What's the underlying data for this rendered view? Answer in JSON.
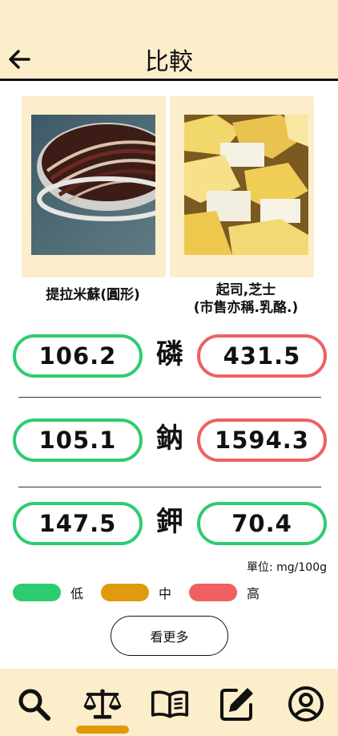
{
  "header": {
    "title": "比較"
  },
  "foods": {
    "left": {
      "name": "提拉米蘇(圓形)"
    },
    "right": {
      "name_line1": "起司,芝士",
      "name_line2": "(市售亦稱.乳酪.)"
    }
  },
  "rows": [
    {
      "nutrient": "磷",
      "left_value": "106.2",
      "left_level": "low",
      "right_value": "431.5",
      "right_level": "high"
    },
    {
      "nutrient": "鈉",
      "left_value": "105.1",
      "left_level": "low",
      "right_value": "1594.3",
      "right_level": "high"
    },
    {
      "nutrient": "鉀",
      "left_value": "147.5",
      "left_level": "low",
      "right_value": "70.4",
      "right_level": "low"
    }
  ],
  "unit": "單位: mg/100g",
  "legend": [
    {
      "label": "低",
      "color": "#2ecc71"
    },
    {
      "label": "中",
      "color": "#e09a0c"
    },
    {
      "label": "高",
      "color": "#f06060"
    }
  ],
  "more_button": "看更多",
  "colors": {
    "low": "#2ecc71",
    "medium": "#e09a0c",
    "high": "#f06060",
    "background": "#fdeecb"
  },
  "nav": {
    "items": [
      "search-icon",
      "scale-icon",
      "book-icon",
      "edit-icon",
      "user-icon"
    ],
    "active": "scale-icon"
  }
}
